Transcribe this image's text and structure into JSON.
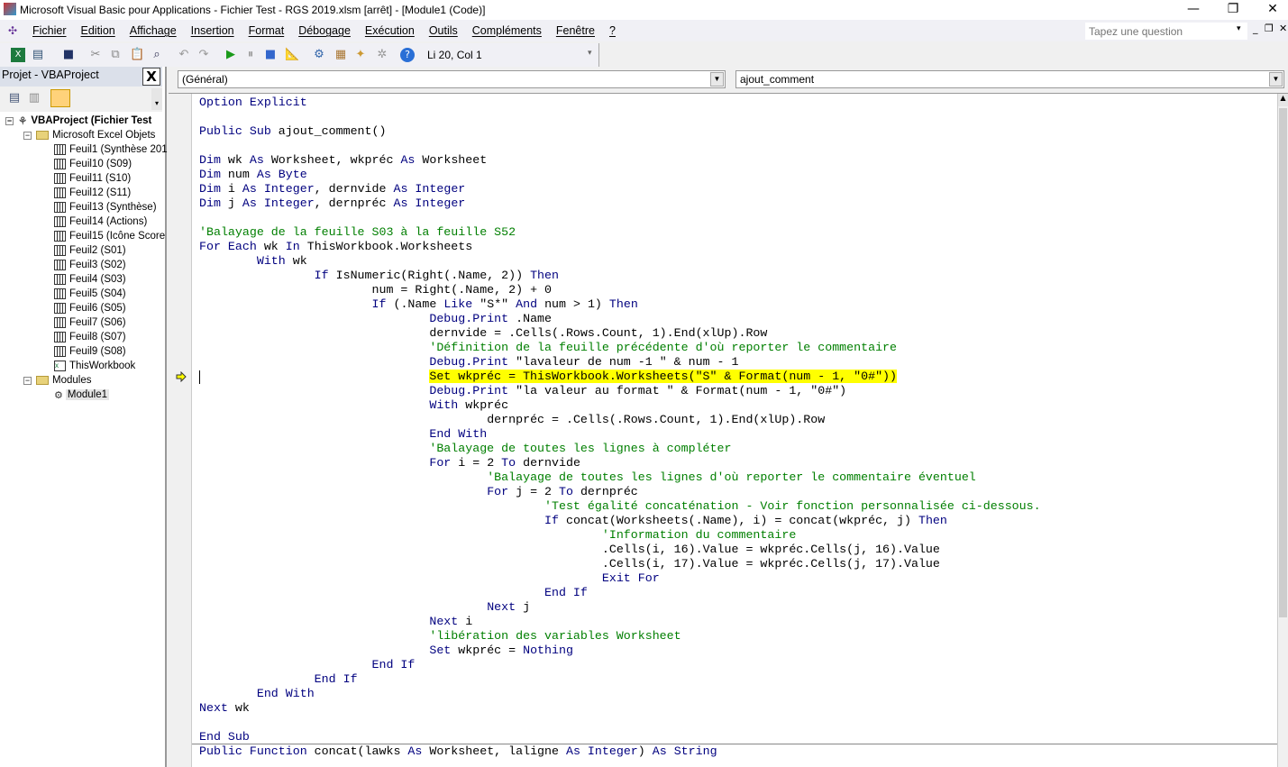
{
  "window": {
    "title": "Microsoft Visual Basic pour Applications - Fichier Test - RGS 2019.xlsm [arrêt] - [Module1 (Code)]"
  },
  "menu": [
    "Fichier",
    "Edition",
    "Affichage",
    "Insertion",
    "Format",
    "Débogage",
    "Exécution",
    "Outils",
    "Compléments",
    "Fenêtre",
    "?"
  ],
  "help_box": {
    "placeholder": "Tapez une question"
  },
  "toolbar": {
    "position": "Li 20, Col 1",
    "icons": [
      "excel-icon",
      "insert-userform-icon",
      "save-icon",
      "cut-icon",
      "copy-icon",
      "paste-icon",
      "find-icon",
      "undo-icon",
      "redo-icon",
      "run-icon",
      "pause-icon",
      "reset-icon",
      "design-mode-icon",
      "project-explorer-icon",
      "properties-icon",
      "object-browser-icon",
      "toolbox-icon",
      "help-icon"
    ]
  },
  "project": {
    "title": "Projet - VBAProject",
    "close": "X",
    "root": "VBAProject (Fichier Test",
    "folder_objects": "Microsoft Excel Objets",
    "sheets": [
      "Feuil1 (Synthèse 201",
      "Feuil10 (S09)",
      "Feuil11 (S10)",
      "Feuil12 (S11)",
      "Feuil13 (Synthèse)",
      "Feuil14 (Actions)",
      "Feuil15 (Icône Score",
      "Feuil2 (S01)",
      "Feuil3 (S02)",
      "Feuil4 (S03)",
      "Feuil5 (S04)",
      "Feuil6 (S05)",
      "Feuil7 (S06)",
      "Feuil8 (S07)",
      "Feuil9 (S08)"
    ],
    "workbook": "ThisWorkbook",
    "folder_modules": "Modules",
    "module": "Module1"
  },
  "editor": {
    "object_combo": "(Général)",
    "proc_combo": "ajout_comment",
    "highlight_color": "#ffff00",
    "keyword_color": "#00007f",
    "comment_color": "#007f00",
    "lines": [
      {
        "i": 0,
        "s": [
          [
            "k",
            "Option Explicit"
          ]
        ]
      },
      {
        "i": 0,
        "s": []
      },
      {
        "i": 0,
        "s": [
          [
            "k",
            "Public Sub"
          ],
          [
            "t",
            " ajout_comment()"
          ]
        ]
      },
      {
        "i": 0,
        "s": []
      },
      {
        "i": 0,
        "s": [
          [
            "k",
            "Dim"
          ],
          [
            "t",
            " wk "
          ],
          [
            "k",
            "As"
          ],
          [
            "t",
            " Worksheet, wkpréc "
          ],
          [
            "k",
            "As"
          ],
          [
            "t",
            " Worksheet"
          ]
        ]
      },
      {
        "i": 0,
        "s": [
          [
            "k",
            "Dim"
          ],
          [
            "t",
            " num "
          ],
          [
            "k",
            "As Byte"
          ]
        ]
      },
      {
        "i": 0,
        "s": [
          [
            "k",
            "Dim"
          ],
          [
            "t",
            " i "
          ],
          [
            "k",
            "As Integer"
          ],
          [
            "t",
            ", dernvide "
          ],
          [
            "k",
            "As Integer"
          ]
        ]
      },
      {
        "i": 0,
        "s": [
          [
            "k",
            "Dim"
          ],
          [
            "t",
            " j "
          ],
          [
            "k",
            "As Integer"
          ],
          [
            "t",
            ", dernpréc "
          ],
          [
            "k",
            "As Integer"
          ]
        ]
      },
      {
        "i": 0,
        "s": []
      },
      {
        "i": 0,
        "s": [
          [
            "c",
            "'Balayage de la feuille S03 à la feuille S52"
          ]
        ]
      },
      {
        "i": 0,
        "s": [
          [
            "k",
            "For Each"
          ],
          [
            "t",
            " wk "
          ],
          [
            "k",
            "In"
          ],
          [
            "t",
            " ThisWorkbook.Worksheets"
          ]
        ]
      },
      {
        "i": 1,
        "s": [
          [
            "k",
            "With"
          ],
          [
            "t",
            " wk"
          ]
        ]
      },
      {
        "i": 2,
        "s": [
          [
            "k",
            "If"
          ],
          [
            "t",
            " IsNumeric(Right(.Name, 2)) "
          ],
          [
            "k",
            "Then"
          ]
        ]
      },
      {
        "i": 3,
        "s": [
          [
            "t",
            "num = Right(.Name, 2) + 0"
          ]
        ]
      },
      {
        "i": 3,
        "s": [
          [
            "k",
            "If"
          ],
          [
            "t",
            " (.Name "
          ],
          [
            "k",
            "Like"
          ],
          [
            "t",
            " \"S*\" "
          ],
          [
            "k",
            "And"
          ],
          [
            "t",
            " num > 1) "
          ],
          [
            "k",
            "Then"
          ]
        ]
      },
      {
        "i": 4,
        "s": [
          [
            "k",
            "Debug.Print"
          ],
          [
            "t",
            " .Name"
          ]
        ]
      },
      {
        "i": 4,
        "s": [
          [
            "t",
            "dernvide = .Cells(.Rows.Count, 1).End(xlUp).Row"
          ]
        ]
      },
      {
        "i": 4,
        "s": [
          [
            "c",
            "'Définition de la feuille précédente d'où reporter le commentaire"
          ]
        ]
      },
      {
        "i": 4,
        "s": [
          [
            "k",
            "Debug.Print"
          ],
          [
            "t",
            " \"lavaleur de num -1 \" & num - 1"
          ]
        ]
      },
      {
        "i": 4,
        "hl": true,
        "s": [
          [
            "t",
            "Set wkpréc = ThisWorkbook.Worksheets(\"S\" & Format(num - 1, \"0#\"))"
          ]
        ]
      },
      {
        "i": 4,
        "s": [
          [
            "k",
            "Debug.Print"
          ],
          [
            "t",
            " \"la valeur au format \" & Format(num - 1, \"0#\")"
          ]
        ]
      },
      {
        "i": 4,
        "s": [
          [
            "k",
            "With"
          ],
          [
            "t",
            " wkpréc"
          ]
        ]
      },
      {
        "i": 5,
        "s": [
          [
            "t",
            "dernpréc = .Cells(.Rows.Count, 1).End(xlUp).Row"
          ]
        ]
      },
      {
        "i": 4,
        "s": [
          [
            "k",
            "End With"
          ]
        ]
      },
      {
        "i": 4,
        "s": [
          [
            "c",
            "'Balayage de toutes les lignes à compléter"
          ]
        ]
      },
      {
        "i": 4,
        "s": [
          [
            "k",
            "For"
          ],
          [
            "t",
            " i = 2 "
          ],
          [
            "k",
            "To"
          ],
          [
            "t",
            " dernvide"
          ]
        ]
      },
      {
        "i": 5,
        "s": [
          [
            "c",
            "'Balayage de toutes les lignes d'où reporter le commentaire éventuel"
          ]
        ]
      },
      {
        "i": 5,
        "s": [
          [
            "k",
            "For"
          ],
          [
            "t",
            " j = 2 "
          ],
          [
            "k",
            "To"
          ],
          [
            "t",
            " dernpréc"
          ]
        ]
      },
      {
        "i": 6,
        "s": [
          [
            "c",
            "'Test égalité concaténation - Voir fonction personnalisée ci-dessous."
          ]
        ]
      },
      {
        "i": 6,
        "s": [
          [
            "k",
            "If"
          ],
          [
            "t",
            " concat(Worksheets(.Name), i) = concat(wkpréc, j) "
          ],
          [
            "k",
            "Then"
          ]
        ]
      },
      {
        "i": 7,
        "s": [
          [
            "c",
            "'Information du commentaire"
          ]
        ]
      },
      {
        "i": 7,
        "s": [
          [
            "t",
            ".Cells(i, 16).Value = wkpréc.Cells(j, 16).Value"
          ]
        ]
      },
      {
        "i": 7,
        "s": [
          [
            "t",
            ".Cells(i, 17).Value = wkpréc.Cells(j, 17).Value"
          ]
        ]
      },
      {
        "i": 7,
        "s": [
          [
            "k",
            "Exit For"
          ]
        ]
      },
      {
        "i": 6,
        "s": [
          [
            "k",
            "End If"
          ]
        ]
      },
      {
        "i": 5,
        "s": [
          [
            "k",
            "Next"
          ],
          [
            "t",
            " j"
          ]
        ]
      },
      {
        "i": 4,
        "s": [
          [
            "k",
            "Next"
          ],
          [
            "t",
            " i"
          ]
        ]
      },
      {
        "i": 4,
        "s": [
          [
            "c",
            "'libération des variables Worksheet"
          ]
        ]
      },
      {
        "i": 4,
        "s": [
          [
            "k",
            "Set"
          ],
          [
            "t",
            " wkpréc = "
          ],
          [
            "k",
            "Nothing"
          ]
        ]
      },
      {
        "i": 3,
        "s": [
          [
            "k",
            "End If"
          ]
        ]
      },
      {
        "i": 2,
        "s": [
          [
            "k",
            "End If"
          ]
        ]
      },
      {
        "i": 1,
        "s": [
          [
            "k",
            "End With"
          ]
        ]
      },
      {
        "i": 0,
        "s": [
          [
            "k",
            "Next"
          ],
          [
            "t",
            " wk"
          ]
        ]
      },
      {
        "i": 0,
        "s": []
      },
      {
        "i": 0,
        "s": [
          [
            "k",
            "End Sub"
          ]
        ]
      },
      {
        "i": 0,
        "s": [
          [
            "k",
            "Public Function"
          ],
          [
            "t",
            " concat(lawks "
          ],
          [
            "k",
            "As"
          ],
          [
            "t",
            " Worksheet, laligne "
          ],
          [
            "k",
            "As Integer"
          ],
          [
            "t",
            ") "
          ],
          [
            "k",
            "As String"
          ]
        ]
      }
    ]
  }
}
